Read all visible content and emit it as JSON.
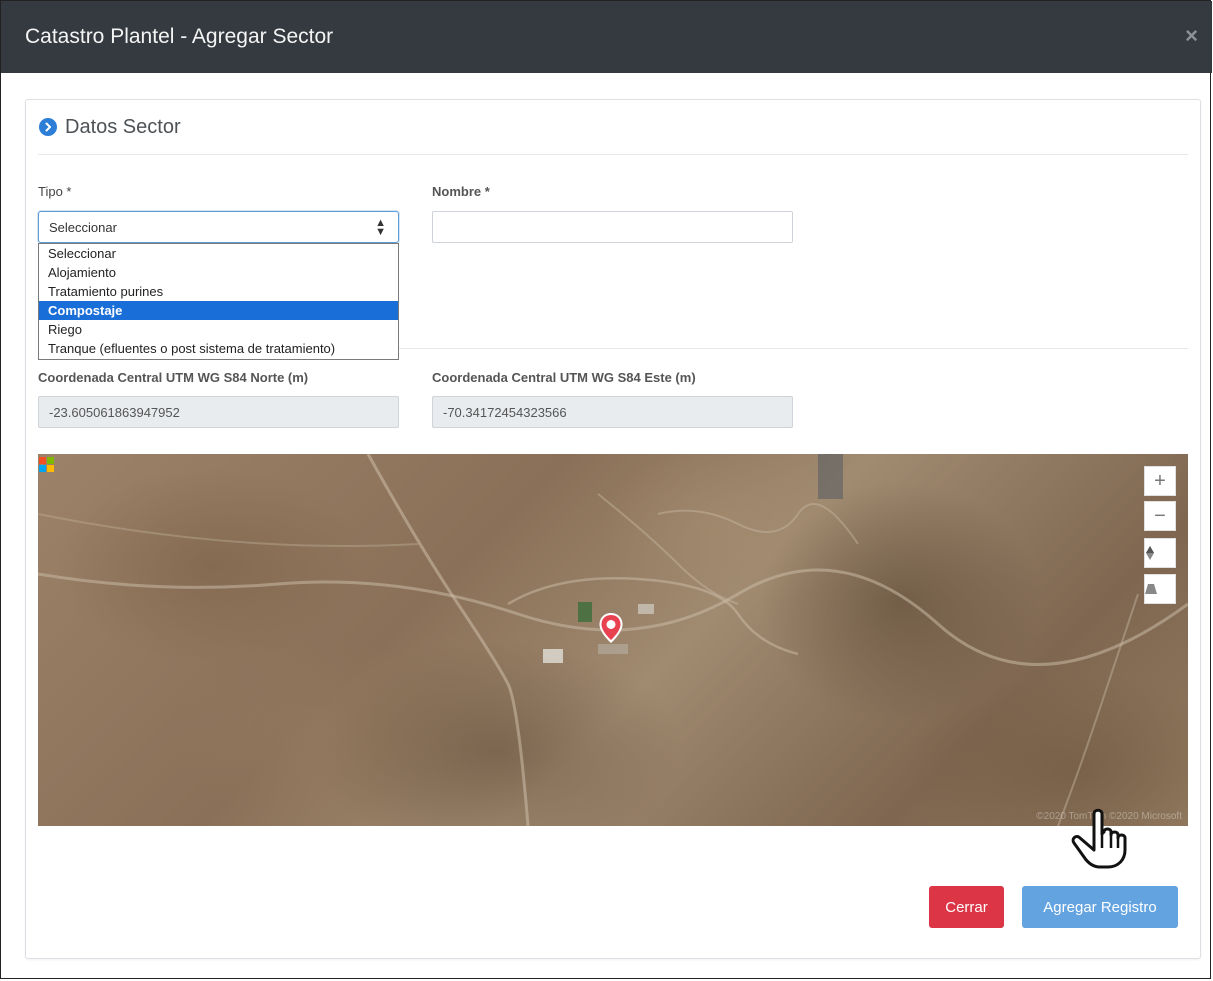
{
  "window": {
    "title": "Catastro Plantel - Agregar Sector",
    "close_glyph": "×"
  },
  "section": {
    "title": "Datos Sector",
    "icon": "chevron-right-circle-icon"
  },
  "form": {
    "tipo": {
      "label": "Tipo *",
      "value": "Seleccionar",
      "options": [
        "Seleccionar",
        "Alojamiento",
        "Tratamiento purines",
        "Compostaje",
        "Riego",
        "Tranque (efluentes o post sistema de tratamiento)"
      ],
      "highlighted_option": "Compostaje"
    },
    "nombre": {
      "label": "Nombre *",
      "value": ""
    },
    "norte": {
      "label": "Coordenada Central UTM WG S84 Norte (m)",
      "value": "-23.605061863947952"
    },
    "este": {
      "label": "Coordenada Central UTM WG S84 Este (m)",
      "value": "-70.34172454323566"
    }
  },
  "map": {
    "provider": "Microsoft",
    "attribution": "©2020 TomTom ©2020 Microsoft",
    "controls": {
      "zoom_in": "+",
      "zoom_out": "−"
    }
  },
  "buttons": {
    "close": "Cerrar",
    "add": "Agregar Registro"
  },
  "colors": {
    "titlebar": "#343a40",
    "accent": "#2c7ed6",
    "danger": "#dc3545",
    "primary": "#62a3e0",
    "highlight": "#1a6ed8"
  }
}
